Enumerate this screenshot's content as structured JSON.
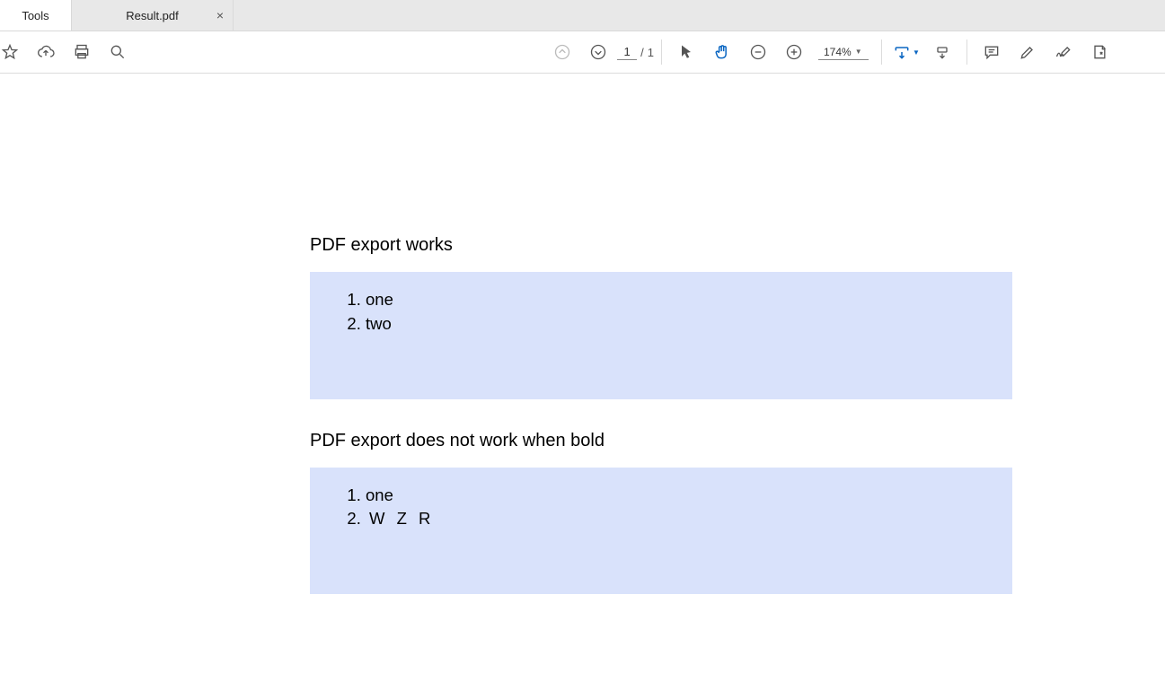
{
  "tabs": {
    "tools": "Tools",
    "file": "Result.pdf"
  },
  "nav": {
    "current_page": "1",
    "total_pages": "1",
    "page_sep": "/",
    "zoom": "174%"
  },
  "doc": {
    "section1": {
      "title": "PDF export works",
      "items": [
        "one",
        "two"
      ]
    },
    "section2": {
      "title": "PDF export does not work when bold",
      "items": [
        "one",
        "W Z R"
      ]
    }
  }
}
